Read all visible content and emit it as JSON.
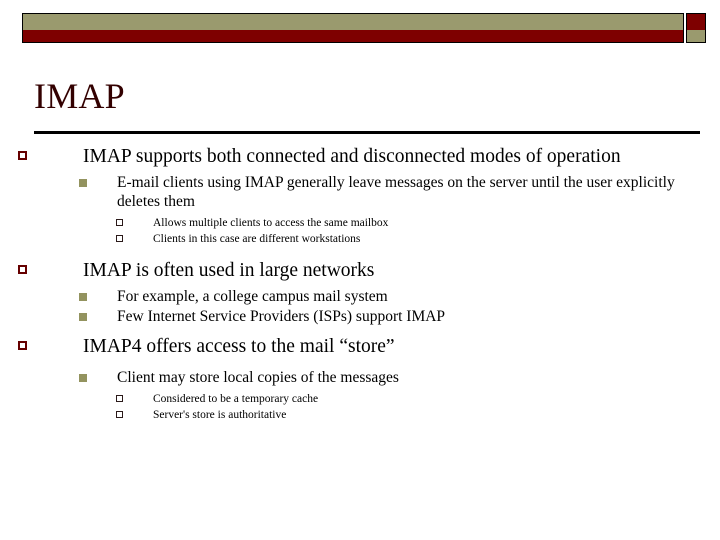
{
  "slide": {
    "title": "IMAP",
    "theme": {
      "khaki": "#9a9a6e",
      "dark_red": "#7e0000",
      "title_color": "#330000",
      "rule_color": "#000000",
      "bullet_l1_color": "#660000",
      "bullet_l2_color": "#93935f",
      "bullet_l3_color": "#2b1a1a",
      "background": "#ffffff"
    },
    "decoration": {
      "bar_top_name": "khaki-bar",
      "bar_bottom_name": "dark-red-bar",
      "corner_top_name": "dark-red-square",
      "corner_bottom_name": "khaki-square"
    },
    "bullets": [
      {
        "level": 1,
        "marker": "hollow-square-bullet",
        "text": "IMAP supports both connected and disconnected modes of operation"
      },
      {
        "level": 2,
        "marker": "filled-square-bullet",
        "text": "E-mail clients using IMAP generally leave messages on the server until the user explicitly deletes them"
      },
      {
        "level": 3,
        "marker": "hollow-square-bullet",
        "text": "Allows multiple clients to access the same mailbox"
      },
      {
        "level": 3,
        "marker": "hollow-square-bullet",
        "text": "Clients in this case are different workstations"
      },
      {
        "level": 1,
        "marker": "hollow-square-bullet",
        "text": "IMAP is often used in large networks"
      },
      {
        "level": 2,
        "marker": "filled-square-bullet",
        "text": "For example, a college campus mail system"
      },
      {
        "level": 2,
        "marker": "filled-square-bullet",
        "text": "Few Internet Service Providers (ISPs) support IMAP"
      },
      {
        "level": 1,
        "marker": "hollow-square-bullet",
        "text": "IMAP4 offers access to the mail “store”"
      },
      {
        "level": 2,
        "marker": "filled-square-bullet",
        "text": "Client may store local copies of the messages"
      },
      {
        "level": 3,
        "marker": "hollow-square-bullet",
        "text": "Considered to be a temporary cache"
      },
      {
        "level": 3,
        "marker": "hollow-square-bullet",
        "text": "Server's store is authoritative"
      }
    ]
  }
}
